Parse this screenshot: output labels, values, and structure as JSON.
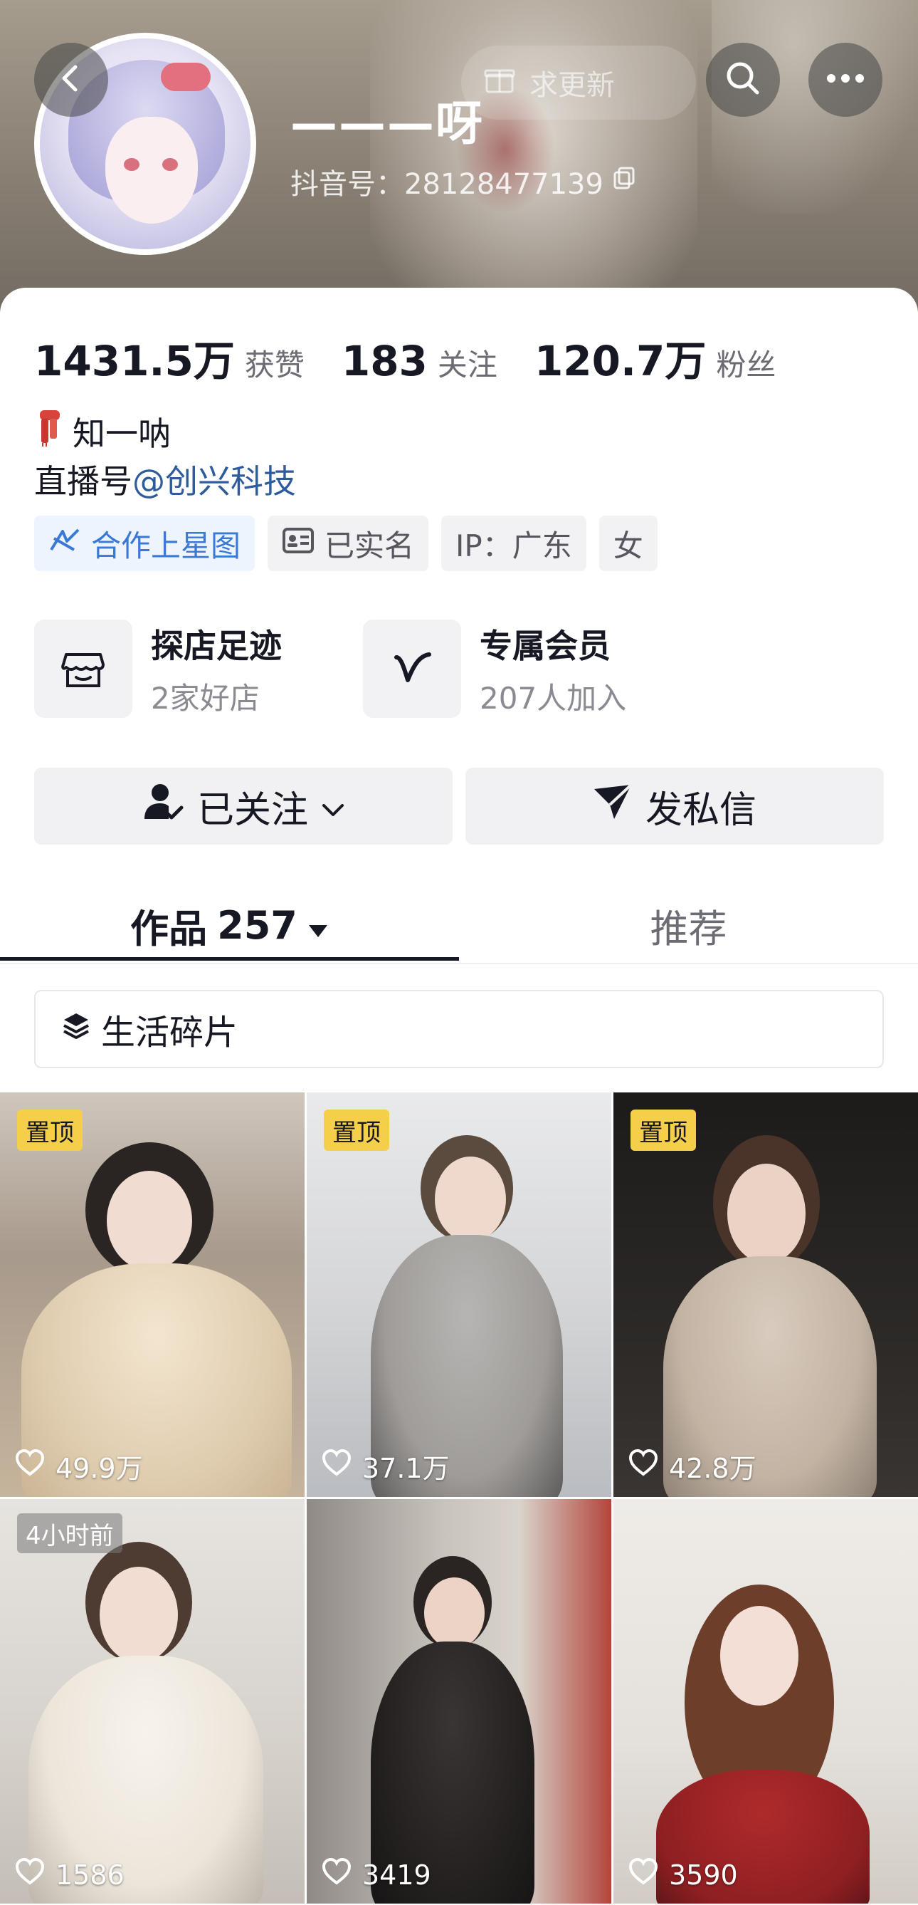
{
  "header": {
    "follow_update_label": "求更新",
    "nickname": "———呀",
    "douyin_id": "抖音号：28128477139"
  },
  "stats": [
    {
      "value": "1431.5万",
      "label": "获赞"
    },
    {
      "value": "183",
      "label": "关注"
    },
    {
      "value": "120.7万",
      "label": "粉丝"
    }
  ],
  "bio": {
    "line1": "知一呐",
    "line2_prefix": "直播号",
    "line2_link": "@创兴科技"
  },
  "tags": [
    {
      "label": "合作上星图",
      "icon": "star-map-icon"
    },
    {
      "label": "已实名",
      "icon": "id-card-icon"
    },
    {
      "label": "IP：广东"
    },
    {
      "label": "女"
    }
  ],
  "services": [
    {
      "title": "探店足迹",
      "subtitle": "2家好店",
      "icon": "store-icon"
    },
    {
      "title": "专属会员",
      "subtitle": "207人加入",
      "icon": "vip-icon"
    }
  ],
  "actions": {
    "followed_label": "已关注",
    "message_label": "发私信"
  },
  "tabs": {
    "works_label": "作品",
    "works_count": "257",
    "recommend_label": "推荐"
  },
  "collection": {
    "label": "生活碎片"
  },
  "videos": [
    {
      "badge": "置顶",
      "likes": "49.9万"
    },
    {
      "badge": "置顶",
      "likes": "37.1万"
    },
    {
      "badge": "置顶",
      "likes": "42.8万"
    },
    {
      "badge": "4小时前",
      "likes": "1586"
    },
    {
      "badge": "",
      "likes": "3419"
    },
    {
      "badge": "",
      "likes": "3590"
    }
  ],
  "colors": {
    "top_badge": "#f6cf4a",
    "link": "#2d5b9c",
    "star_map_tag": "#3a79d6"
  }
}
